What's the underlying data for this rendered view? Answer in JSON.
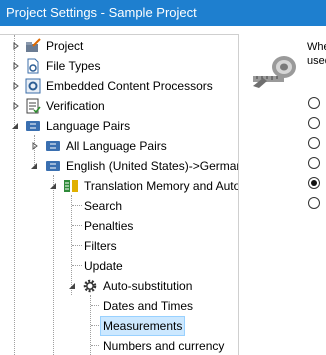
{
  "window": {
    "title": "Project Settings - Sample Project"
  },
  "tree": {
    "project": "Project",
    "file_types": "File Types",
    "embedded": "Embedded Content Processors",
    "verification": "Verification",
    "language_pairs": "Language Pairs",
    "all_language_pairs": "All Language Pairs",
    "english_german": "English (United States)->German (",
    "translation_memory": "Translation Memory and Auto",
    "search": "Search",
    "penalties": "Penalties",
    "filters": "Filters",
    "update": "Update",
    "auto_substitution": "Auto-substitution",
    "dates_times": "Dates and Times",
    "measurements": "Measurements",
    "numbers_currency": "Numbers and currency"
  },
  "panel": {
    "description_line1": "Whe",
    "description_line2": "used",
    "selected_option_index": 4
  }
}
